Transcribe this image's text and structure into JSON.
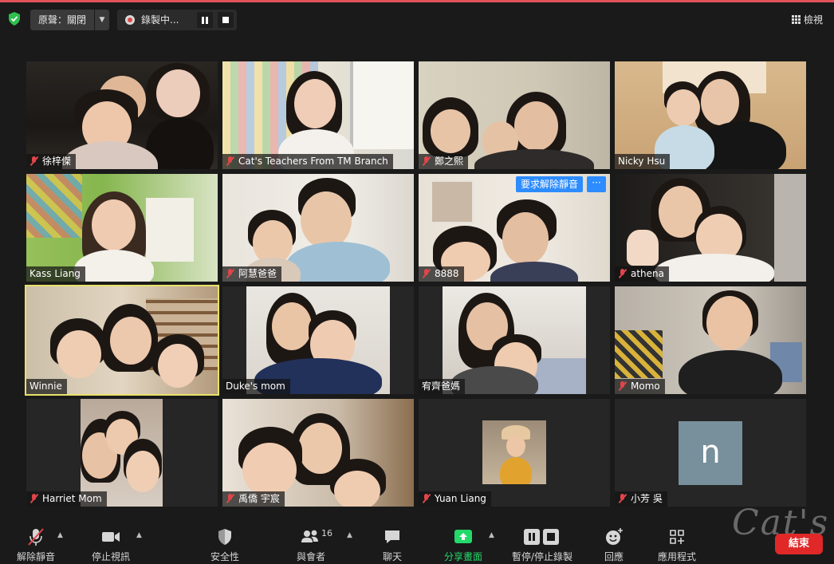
{
  "topbar": {
    "audio_label": "原聲：關閉",
    "recording_label": "錄製中...",
    "view_label": "檢視"
  },
  "tiles": [
    {
      "name": "徐梓傑",
      "muted": true
    },
    {
      "name": "Cat's Teachers From TM Branch",
      "muted": true
    },
    {
      "name": "鄭之熙",
      "muted": true
    },
    {
      "name": "Nicky Hsu",
      "muted": false
    },
    {
      "name": "Kass Liang",
      "muted": false
    },
    {
      "name": "阿慧爸爸",
      "muted": true
    },
    {
      "name": "8888",
      "muted": true,
      "unmute_request": "要求解除靜音",
      "more": "···"
    },
    {
      "name": "athena",
      "muted": true
    },
    {
      "name": "Winnie",
      "muted": false
    },
    {
      "name": "Duke's mom",
      "muted": false
    },
    {
      "name": "宥齊爸媽",
      "muted": false
    },
    {
      "name": "Momo",
      "muted": true
    },
    {
      "name": "Harriet Mom",
      "muted": true
    },
    {
      "name": "禹僑 宇宸",
      "muted": true
    },
    {
      "name": "Yuan Liang",
      "muted": true
    },
    {
      "name": "小芳 吳",
      "muted": true,
      "avatar_letter": "n"
    }
  ],
  "toolbar": {
    "unmute": "解除靜音",
    "stop_video": "停止視訊",
    "security": "安全性",
    "participants": "與會者",
    "participants_count": "16",
    "chat": "聊天",
    "share_screen": "分享畫面",
    "pause_stop_recording": "暫停/停止錄製",
    "reactions": "回應",
    "apps": "應用程式",
    "end": "結束"
  },
  "watermark": "Cat's",
  "colors": {
    "accent": "#e0545a",
    "active_speaker": "#e9e16a",
    "share_green": "#23d96a",
    "end_red": "#e02828",
    "unmute_blue": "#2d8cff"
  }
}
